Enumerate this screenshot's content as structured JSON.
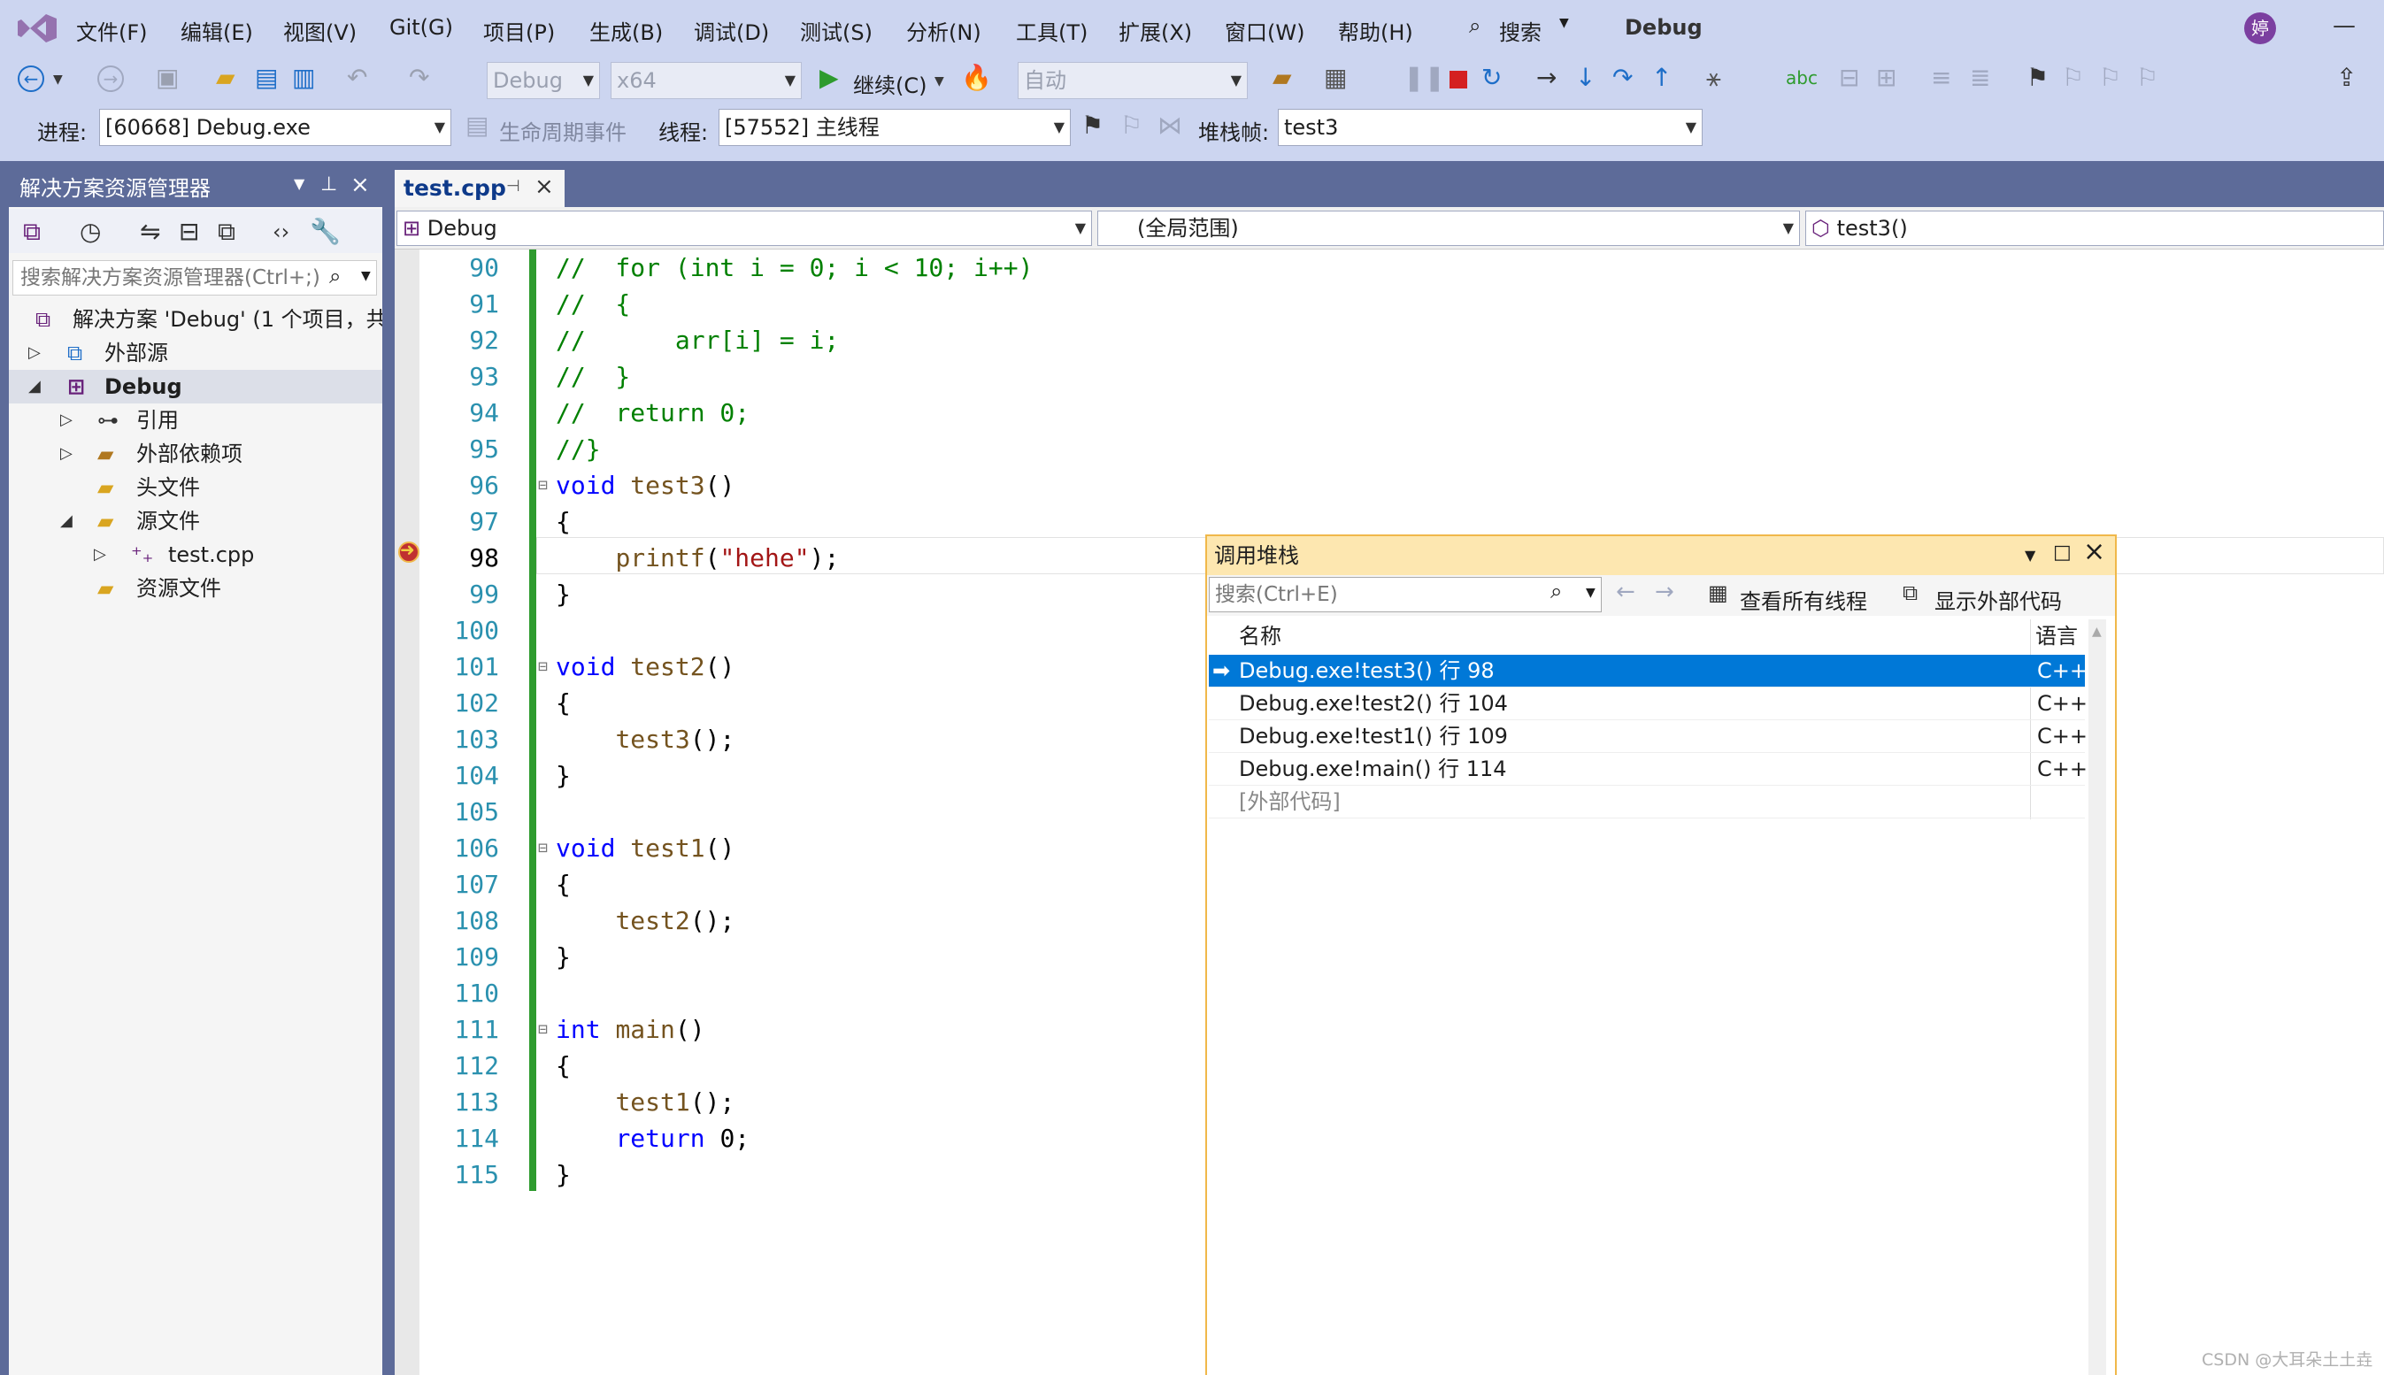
{
  "menu": {
    "items": [
      "文件(F)",
      "编辑(E)",
      "视图(V)",
      "Git(G)",
      "项目(P)",
      "生成(B)",
      "调试(D)",
      "测试(S)",
      "分析(N)",
      "工具(T)",
      "扩展(X)",
      "窗口(W)",
      "帮助(H)"
    ],
    "search": "搜索",
    "solution_name": "Debug",
    "avatar": "婷"
  },
  "toolbar": {
    "config": "Debug",
    "platform": "x64",
    "continue": "继续(C)",
    "auto": "自动"
  },
  "debugbar": {
    "process_label": "进程:",
    "process": "[60668] Debug.exe",
    "lifecycle": "生命周期事件",
    "thread_label": "线程:",
    "thread": "[57552] 主线程",
    "stackframe_label": "堆栈帧:",
    "stackframe": "test3"
  },
  "solution_explorer": {
    "title": "解决方案资源管理器",
    "search_placeholder": "搜索解决方案资源管理器(Ctrl+;)",
    "tree": [
      "解决方案 'Debug' (1 个项目，共",
      "外部源",
      "Debug",
      "引用",
      "外部依赖项",
      "头文件",
      "源文件",
      "test.cpp",
      "资源文件"
    ]
  },
  "editor": {
    "tab": "test.cpp",
    "project_scope": "Debug",
    "global_scope": "(全局范围)",
    "function_scope": "test3()",
    "current_line": 98,
    "lines": [
      {
        "n": 90,
        "t": "//  for (int i = 0; i < 10; i++)"
      },
      {
        "n": 91,
        "t": "//  {"
      },
      {
        "n": 92,
        "t": "//      arr[i] = i;"
      },
      {
        "n": 93,
        "t": "//  }"
      },
      {
        "n": 94,
        "t": "//  return 0;"
      },
      {
        "n": 95,
        "t": "//}"
      },
      {
        "n": 96,
        "t": "void test3()"
      },
      {
        "n": 97,
        "t": "{"
      },
      {
        "n": 98,
        "t": "    printf(\"hehe\");"
      },
      {
        "n": 99,
        "t": "}"
      },
      {
        "n": 100,
        "t": ""
      },
      {
        "n": 101,
        "t": "void test2()"
      },
      {
        "n": 102,
        "t": "{"
      },
      {
        "n": 103,
        "t": "    test3();"
      },
      {
        "n": 104,
        "t": "}"
      },
      {
        "n": 105,
        "t": ""
      },
      {
        "n": 106,
        "t": "void test1()"
      },
      {
        "n": 107,
        "t": "{"
      },
      {
        "n": 108,
        "t": "    test2();"
      },
      {
        "n": 109,
        "t": "}"
      },
      {
        "n": 110,
        "t": ""
      },
      {
        "n": 111,
        "t": "int main()"
      },
      {
        "n": 112,
        "t": "{"
      },
      {
        "n": 113,
        "t": "    test1();"
      },
      {
        "n": 114,
        "t": "    return 0;"
      },
      {
        "n": 115,
        "t": "}"
      }
    ]
  },
  "call_stack": {
    "title": "调用堆栈",
    "search_placeholder": "搜索(Ctrl+E)",
    "view_all_threads": "查看所有线程",
    "show_external": "显示外部代码",
    "col_name": "名称",
    "col_lang": "语言",
    "rows": [
      {
        "name": "Debug.exe!test3() 行 98",
        "lang": "C++"
      },
      {
        "name": "Debug.exe!test2() 行 104",
        "lang": "C++"
      },
      {
        "name": "Debug.exe!test1() 行 109",
        "lang": "C++"
      },
      {
        "name": "Debug.exe!main() 行 114",
        "lang": "C++"
      },
      {
        "name": "[外部代码]",
        "lang": ""
      }
    ]
  },
  "watermark": "CSDN @大耳朵土土垚"
}
